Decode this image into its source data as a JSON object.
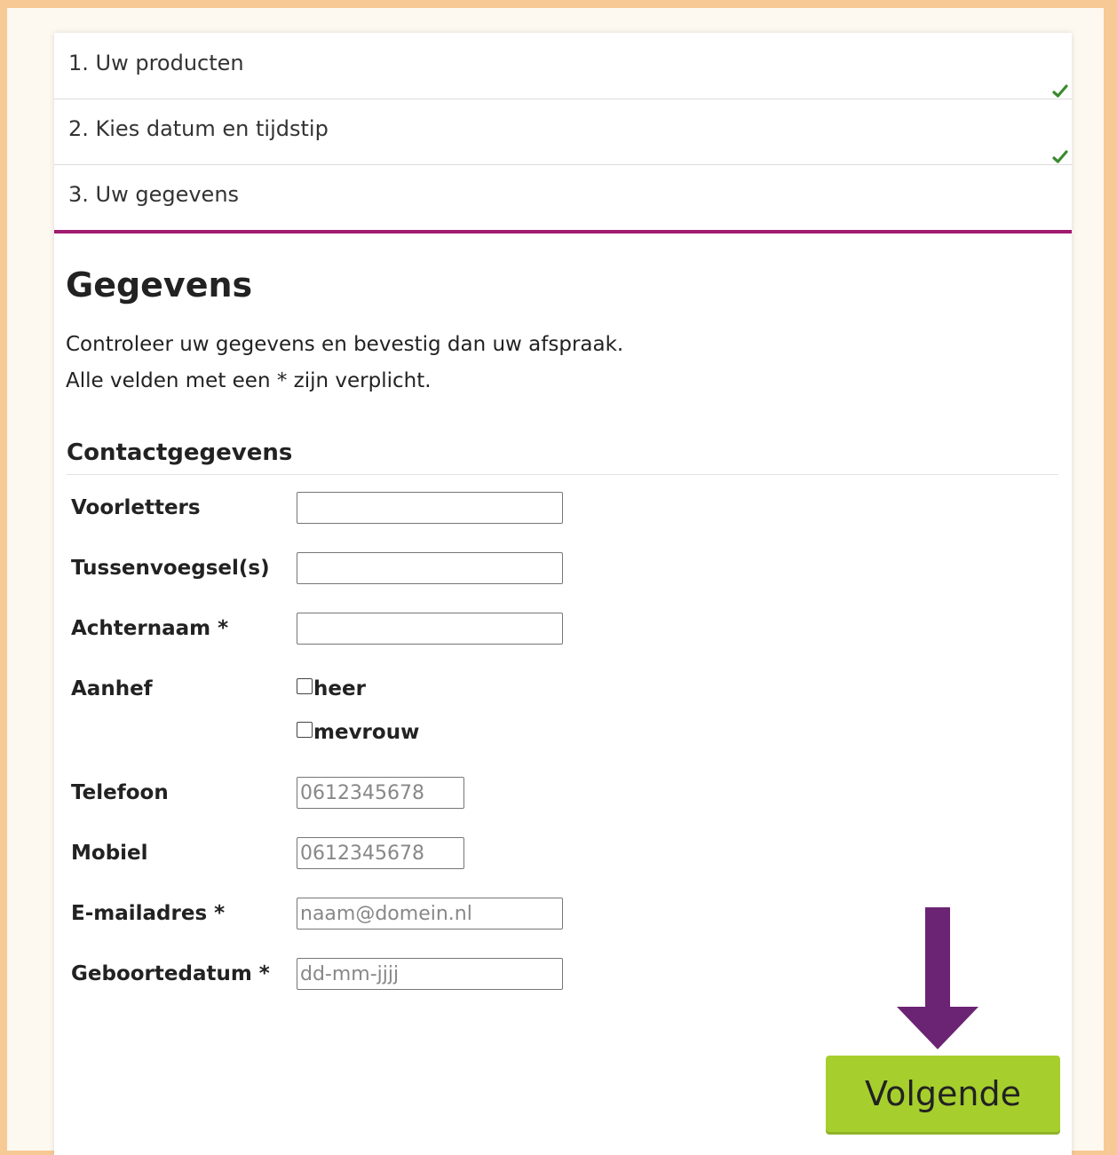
{
  "steps": [
    {
      "label": "1. Uw producten",
      "status": "done"
    },
    {
      "label": "2. Kies datum en tijdstip",
      "status": "done"
    },
    {
      "label": "3. Uw gegevens",
      "status": "active"
    }
  ],
  "heading": "Gegevens",
  "intro_line1": "Controleer uw gegevens en bevestig dan uw afspraak.",
  "intro_line2": "Alle velden met een * zijn verplicht.",
  "section_title": "Contactgegevens",
  "form": {
    "voorletters": {
      "label": "Voorletters",
      "value": ""
    },
    "tussenvoegsel": {
      "label": "Tussenvoegsel(s)",
      "value": ""
    },
    "achternaam": {
      "label": "Achternaam *",
      "value": ""
    },
    "aanhef": {
      "label": "Aanhef",
      "options": [
        "heer",
        "mevrouw"
      ]
    },
    "telefoon": {
      "label": "Telefoon",
      "placeholder": "0612345678"
    },
    "mobiel": {
      "label": "Mobiel",
      "placeholder": "0612345678"
    },
    "email": {
      "label": "E-mailadres *",
      "placeholder": "naam@domein.nl"
    },
    "geboortedatum": {
      "label": "Geboortedatum *",
      "placeholder": "dd-mm-jjjj"
    }
  },
  "next_button": "Volgende",
  "colors": {
    "accent": "#a01a6e",
    "button": "#a6cf2d",
    "check": "#3a8a2e",
    "arrow": "#6b2473",
    "border": "#f7c994"
  },
  "icons": {
    "done": "checkmark-icon",
    "pointer": "arrow-down-icon"
  }
}
